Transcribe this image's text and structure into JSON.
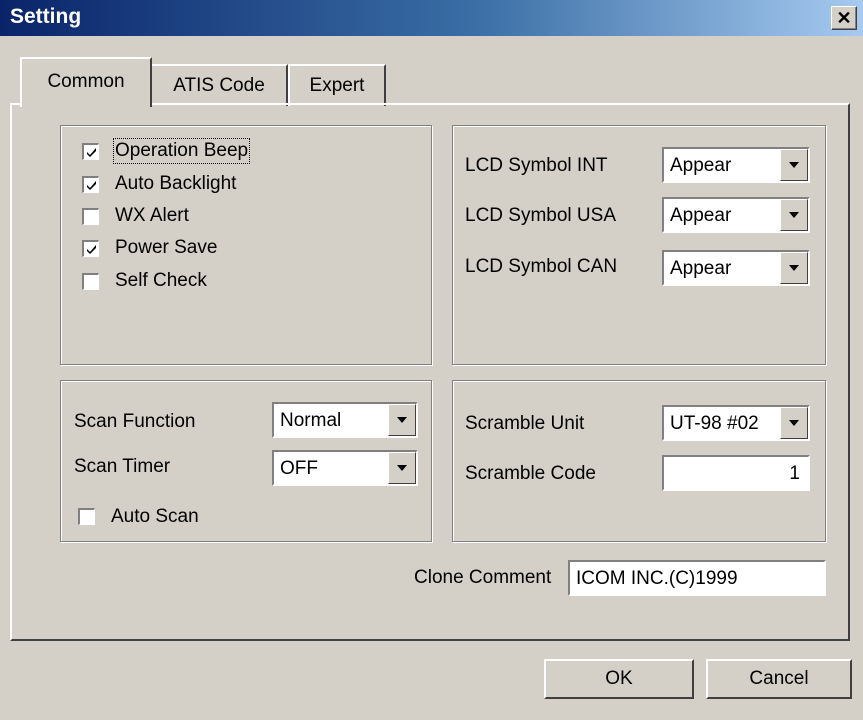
{
  "window": {
    "title": "Setting",
    "close_glyph": "✕"
  },
  "tabs": [
    {
      "label": "Common",
      "active": true
    },
    {
      "label": "ATIS Code",
      "active": false
    },
    {
      "label": "Expert",
      "active": false
    }
  ],
  "checkboxes": [
    {
      "label": "Operation Beep",
      "checked": true
    },
    {
      "label": "Auto Backlight",
      "checked": true
    },
    {
      "label": "WX Alert",
      "checked": false
    },
    {
      "label": "Power Save",
      "checked": true
    },
    {
      "label": "Self Check",
      "checked": false
    }
  ],
  "lcd": {
    "int_label": "LCD Symbol INT",
    "int_value": "Appear",
    "usa_label": "LCD Symbol USA",
    "usa_value": "Appear",
    "can_label": "LCD Symbol CAN",
    "can_value": "Appear"
  },
  "scan": {
    "function_label": "Scan Function",
    "function_value": "Normal",
    "timer_label": "Scan Timer",
    "timer_value": "OFF",
    "auto_label": "Auto Scan",
    "auto_checked": false
  },
  "scramble": {
    "unit_label": "Scramble Unit",
    "unit_value": "UT-98 #02",
    "code_label": "Scramble Code",
    "code_value": "1"
  },
  "clone": {
    "label": "Clone Comment",
    "value": "ICOM INC.(C)1999"
  },
  "buttons": {
    "ok": "OK",
    "cancel": "Cancel"
  },
  "icons": {
    "checkmark": "check-icon",
    "dropdown": "chevron-down-icon",
    "close": "close-icon"
  }
}
